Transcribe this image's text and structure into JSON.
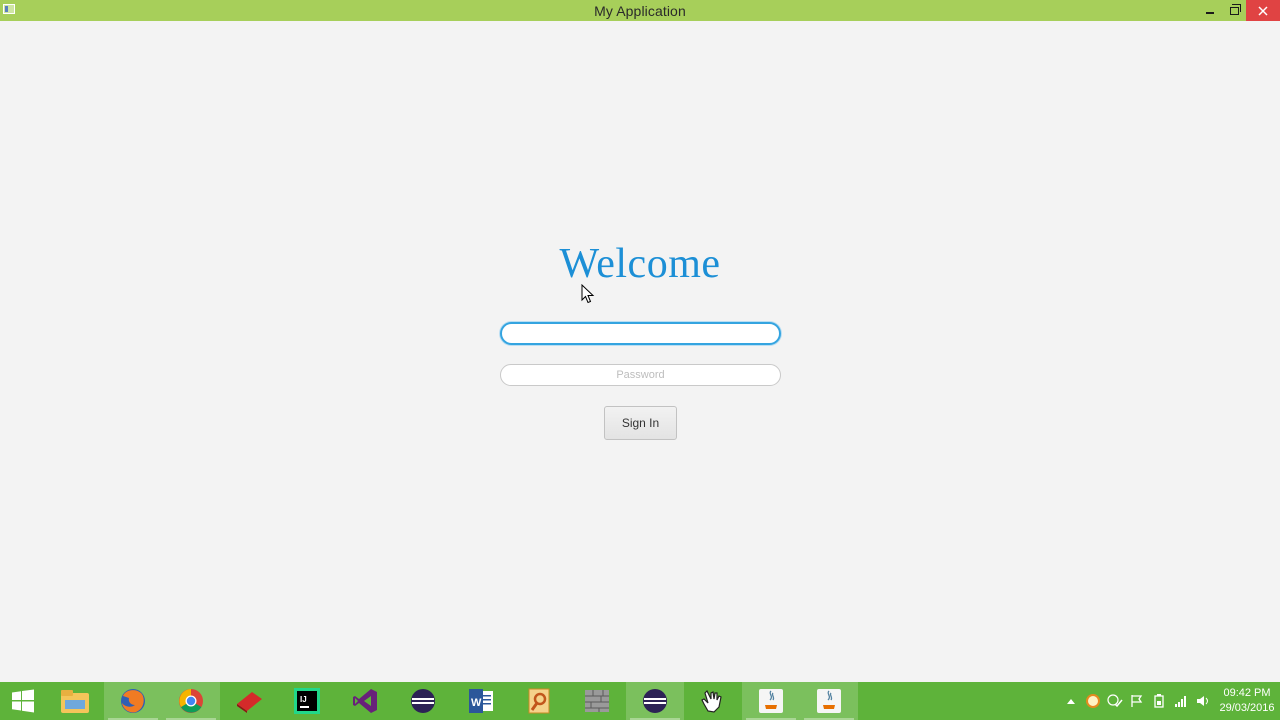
{
  "window": {
    "title": "My Application"
  },
  "login": {
    "heading": "Welcome",
    "username": {
      "value": "",
      "placeholder": ""
    },
    "password": {
      "value": "",
      "placeholder": "Password"
    },
    "signin_label": "Sign In"
  },
  "taskbar": {
    "apps": [
      {
        "name": "file-explorer-icon"
      },
      {
        "name": "firefox-icon"
      },
      {
        "name": "chrome-icon"
      },
      {
        "name": "red-book-icon"
      },
      {
        "name": "intellij-icon"
      },
      {
        "name": "visual-studio-icon"
      },
      {
        "name": "eclipse-icon"
      },
      {
        "name": "word-icon"
      },
      {
        "name": "search-tool-icon"
      },
      {
        "name": "brick-wall-icon"
      },
      {
        "name": "eclipse-icon"
      },
      {
        "name": "hand-pointer-icon"
      },
      {
        "name": "java-icon"
      },
      {
        "name": "java-icon"
      }
    ],
    "clock": {
      "time": "09:42 PM",
      "date": "29/03/2016"
    }
  },
  "colors": {
    "titlebar": "#a7cf5a",
    "taskbar": "#5eb33a",
    "heading": "#1c8fd6",
    "close_button": "#e04343",
    "background": "#f3f3f3"
  }
}
